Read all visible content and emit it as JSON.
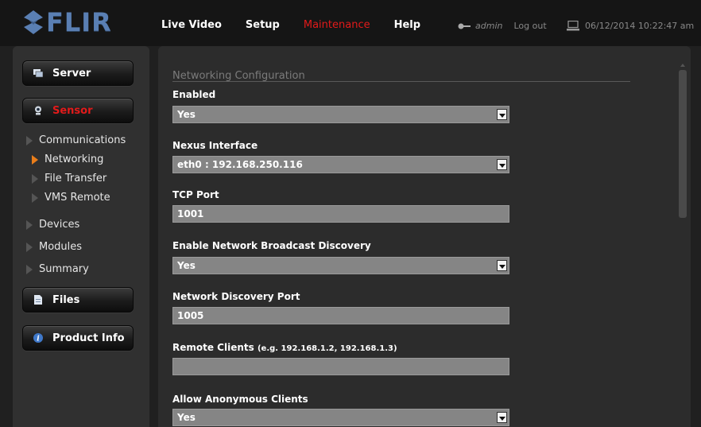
{
  "header": {
    "logo_text": "FLIR",
    "brand_color": "#5a7fb3",
    "nav": [
      {
        "label": "Live Video",
        "active": false
      },
      {
        "label": "Setup",
        "active": false
      },
      {
        "label": "Maintenance",
        "active": true
      },
      {
        "label": "Help",
        "active": false
      }
    ],
    "user": {
      "icon": "key-icon",
      "name": "admin",
      "logout_label": "Log out"
    },
    "datetime": {
      "icon": "computer-icon",
      "text": "06/12/2014 10:22:47 am"
    }
  },
  "sidebar": {
    "server_label": "Server",
    "sensor_label": "Sensor",
    "sensor_items": [
      {
        "label": "Communications",
        "active": false
      },
      {
        "label": "Networking",
        "active": true
      },
      {
        "label": "File Transfer",
        "active": false
      },
      {
        "label": "VMS Remote",
        "active": false
      }
    ],
    "items": [
      {
        "label": "Devices"
      },
      {
        "label": "Modules"
      },
      {
        "label": "Summary"
      }
    ],
    "files_label": "Files",
    "product_info_label": "Product Info"
  },
  "main": {
    "title": "Networking Configuration",
    "fields": {
      "enabled": {
        "label": "Enabled",
        "value": "Yes"
      },
      "nexus": {
        "label": "Nexus Interface",
        "value": "eth0 : 192.168.250.116"
      },
      "tcp_port": {
        "label": "TCP Port",
        "value": "1001"
      },
      "broadcast": {
        "label": "Enable Network Broadcast Discovery",
        "value": "Yes"
      },
      "discovery_port": {
        "label": "Network Discovery Port",
        "value": "1005"
      },
      "remote_clients": {
        "label": "Remote Clients",
        "hint": "(e.g. 192.168.1.2, 192.168.1.3)",
        "value": ""
      },
      "anonymous": {
        "label": "Allow Anonymous Clients",
        "value": "Yes"
      }
    }
  },
  "colors": {
    "active_red": "#e21a1a",
    "active_arrow": "#e97d1a",
    "field_bg": "#858585"
  }
}
